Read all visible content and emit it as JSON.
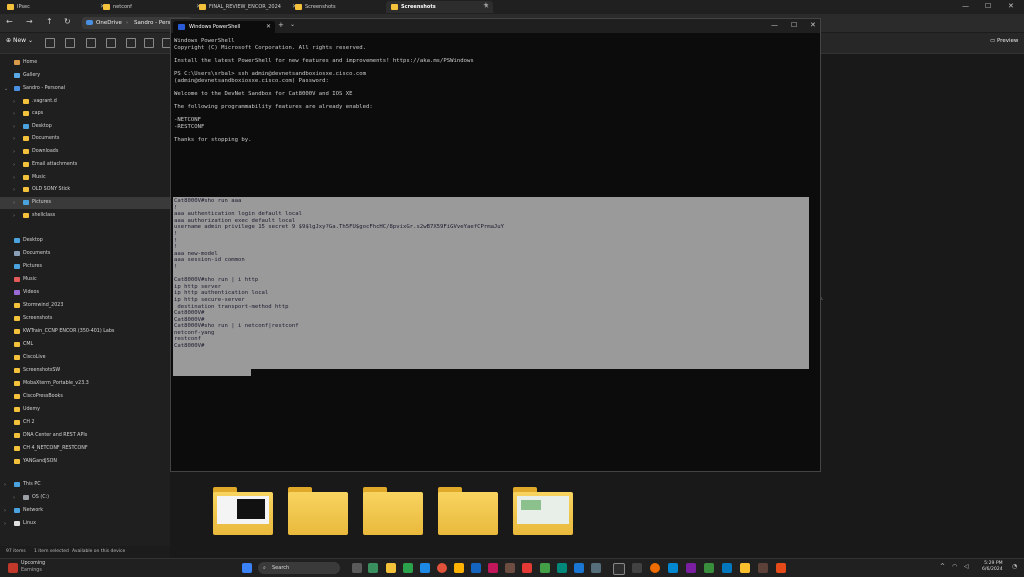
{
  "explorer": {
    "tabs": [
      {
        "label": "IPsec"
      },
      {
        "label": "netconf"
      },
      {
        "label": "FINAL_REVIEW_ENCOR_2024"
      },
      {
        "label": "Screenshots"
      },
      {
        "label": "Screenshots"
      }
    ],
    "add_tab": "+",
    "breadcrumb": [
      "OneDrive",
      "Sandro - Pers"
    ],
    "new_label": "New",
    "preview_label": "Preview",
    "side_text": "ile.",
    "sidebar": [
      {
        "label": "Home",
        "icon": "home-icon",
        "color": "#d99a4a"
      },
      {
        "label": "Gallery",
        "icon": "gallery-icon",
        "color": "#5aa9e6"
      },
      {
        "label": "Sandro - Personal",
        "icon": "onedrive-icon",
        "color": "#4a90e2"
      },
      {
        "label": ".vagrant.d",
        "icon": "folder-icon",
        "color": "#f3c13a"
      },
      {
        "label": "caps",
        "icon": "folder-icon",
        "color": "#f3c13a"
      },
      {
        "label": "Desktop",
        "icon": "desktop-icon",
        "color": "#4aa3df"
      },
      {
        "label": "Documents",
        "icon": "folder-icon",
        "color": "#f3c13a"
      },
      {
        "label": "Downloads",
        "icon": "folder-icon",
        "color": "#f3c13a"
      },
      {
        "label": "Email attachments",
        "icon": "folder-icon",
        "color": "#f3c13a"
      },
      {
        "label": "Music",
        "icon": "folder-icon",
        "color": "#f3c13a"
      },
      {
        "label": "OLD SONY Stick",
        "icon": "folder-icon",
        "color": "#f3c13a"
      },
      {
        "label": "Pictures",
        "icon": "pictures-icon",
        "color": "#4aa3df"
      },
      {
        "label": "shellclass",
        "icon": "folder-icon",
        "color": "#f3c13a"
      },
      {
        "label": "Desktop",
        "icon": "desktop-icon",
        "color": "#4aa3df"
      },
      {
        "label": "Documents",
        "icon": "documents-icon",
        "color": "#8aa0b8"
      },
      {
        "label": "Pictures",
        "icon": "pictures-icon",
        "color": "#4aa3df"
      },
      {
        "label": "Music",
        "icon": "music-icon",
        "color": "#e25a5a"
      },
      {
        "label": "Videos",
        "icon": "videos-icon",
        "color": "#9b6ad6"
      },
      {
        "label": "Stormwind_2023",
        "icon": "folder-icon",
        "color": "#f3c13a"
      },
      {
        "label": "Screenshots",
        "icon": "folder-icon",
        "color": "#f3c13a"
      },
      {
        "label": "KWTrain_CCNP ENCOR (350-401) Labs",
        "icon": "folder-icon",
        "color": "#f3c13a"
      },
      {
        "label": "CML",
        "icon": "folder-icon",
        "color": "#f3c13a"
      },
      {
        "label": "CiscoLive",
        "icon": "folder-icon",
        "color": "#f3c13a"
      },
      {
        "label": "ScreenshotsSW",
        "icon": "folder-icon",
        "color": "#f3c13a"
      },
      {
        "label": "MobaXterm_Portable_v23.3",
        "icon": "folder-icon",
        "color": "#f3c13a"
      },
      {
        "label": "CiscoPressBooks",
        "icon": "folder-icon",
        "color": "#f3c13a"
      },
      {
        "label": "Udemy",
        "icon": "folder-icon",
        "color": "#f3c13a"
      },
      {
        "label": "CH 2",
        "icon": "folder-icon",
        "color": "#f3c13a"
      },
      {
        "label": "DNA Center and REST APIs",
        "icon": "folder-icon",
        "color": "#f3c13a"
      },
      {
        "label": "CH 4_NETCONF_RESTCONF",
        "icon": "folder-icon",
        "color": "#f3c13a"
      },
      {
        "label": "YANGandJSON",
        "icon": "folder-icon",
        "color": "#f3c13a"
      },
      {
        "label": "This PC",
        "icon": "pc-icon",
        "color": "#4aa3df"
      },
      {
        "label": "OS (C:)",
        "icon": "drive-icon",
        "color": "#9aa0a6"
      },
      {
        "label": "Network",
        "icon": "network-icon",
        "color": "#4aa3df"
      },
      {
        "label": "Linux",
        "icon": "linux-icon",
        "color": "#e0e0e0"
      }
    ],
    "status": {
      "items": "97 items",
      "selected": "1 item selected",
      "availability": "Available on this device"
    }
  },
  "powershell": {
    "tab_title": "Windows PowerShell",
    "add_tab": "+",
    "dropdown": "⌄",
    "window_buttons": [
      "—",
      "☐",
      "✕"
    ],
    "lines_plain": [
      "Windows PowerShell",
      "Copyright (C) Microsoft Corporation. All rights reserved.",
      "",
      "Install the latest PowerShell for new features and improvements! https://aka.ms/PSWindows",
      "",
      "PS C:\\Users\\srbal> ssh admin@devnetsandboxiosxe.cisco.com",
      "(admin@devnetsandboxiosxe.cisco.com) Password:",
      "",
      "Welcome to the DevNet Sandbox for Cat8000V and IOS XE",
      "",
      "The following programmability features are already enabled:",
      "",
      "-NETCONF",
      "-RESTCONF",
      "",
      "Thanks for stopping by.",
      "",
      "",
      "",
      "",
      "",
      "",
      ""
    ],
    "lines_selected": [
      "Cat8000V#sho run aaa",
      "!",
      "aaa authentication login default local",
      "aaa authorization exec default local",
      "username admin privilege 15 secret 9 $9$lgJxy?Ga.Th5FU$gocFhcHC/8pvixGr.s2wB7X59FiGVveYaefCPrmaJuY",
      "!",
      "!",
      "!",
      "aaa new-model",
      "aaa session-id common",
      "!",
      "",
      "Cat8000V#sho run | i http",
      "ip http server",
      "ip http authentication local",
      "ip http secure-server",
      " destination transport-method http",
      "Cat8000V#",
      "Cat8000V#",
      "Cat8000V#sho run | i netconf|restconf",
      "netconf-yang",
      "restconf",
      "Cat8000V#"
    ]
  },
  "taskbar": {
    "weather_title": "Upcoming",
    "weather_sub": "Earnings",
    "search_label": "Search",
    "time": "5:29 PM",
    "date": "6/6/2024"
  }
}
